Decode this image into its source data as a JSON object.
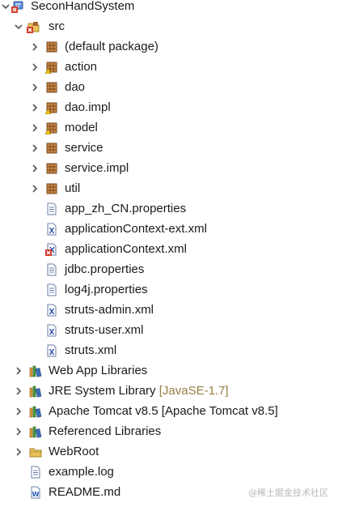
{
  "project": {
    "name": "SeconHandSystem",
    "src": "src"
  },
  "packages": [
    {
      "label": "(default package)",
      "icon": "package-icon"
    },
    {
      "label": "action",
      "icon": "package-icon"
    },
    {
      "label": "dao",
      "icon": "package-icon"
    },
    {
      "label": "dao.impl",
      "icon": "package-icon"
    },
    {
      "label": "model",
      "icon": "package-icon"
    },
    {
      "label": "service",
      "icon": "package-icon"
    },
    {
      "label": "service.impl",
      "icon": "package-icon"
    },
    {
      "label": "util",
      "icon": "package-icon"
    }
  ],
  "src_files": [
    {
      "label": "app_zh_CN.properties",
      "icon": "properties-file-icon"
    },
    {
      "label": "applicationContext-ext.xml",
      "icon": "xml-file-icon"
    },
    {
      "label": "applicationContext.xml",
      "icon": "xml-file-error-icon"
    },
    {
      "label": "jdbc.properties",
      "icon": "properties-file-icon"
    },
    {
      "label": "log4j.properties",
      "icon": "properties-file-icon"
    },
    {
      "label": "struts-admin.xml",
      "icon": "xml-file-icon"
    },
    {
      "label": "struts-user.xml",
      "icon": "xml-file-icon"
    },
    {
      "label": "struts.xml",
      "icon": "xml-file-icon"
    }
  ],
  "libraries": [
    {
      "label": "Web App Libraries",
      "icon": "library-icon"
    },
    {
      "label": "JRE System Library",
      "suffix": "[JavaSE-1.7]",
      "icon": "library-icon"
    },
    {
      "label": "Apache Tomcat v8.5 [Apache Tomcat v8.5]",
      "icon": "library-icon"
    },
    {
      "label": "Referenced Libraries",
      "icon": "library-icon"
    },
    {
      "label": "WebRoot",
      "icon": "folder-icon"
    }
  ],
  "root_files": [
    {
      "label": "example.log",
      "icon": "text-file-icon"
    },
    {
      "label": "README.md",
      "icon": "word-file-icon"
    }
  ],
  "watermark": "@稀土掘金技术社区",
  "colors": {
    "package_brown": "#a8652c",
    "library_green": "#4c9a3e",
    "error_red": "#d23a2a",
    "xml_blue": "#3355aa",
    "folder_yellow": "#e8c25a"
  }
}
